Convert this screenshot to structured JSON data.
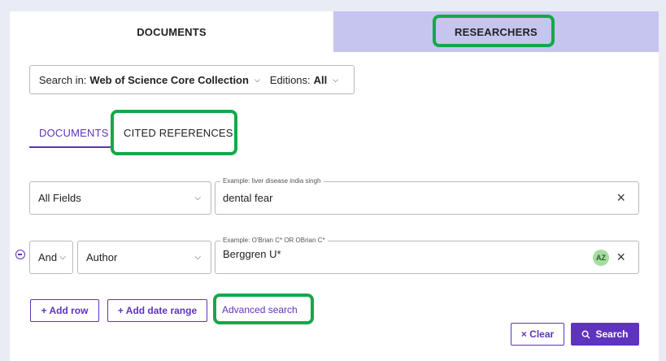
{
  "top_tabs": {
    "documents": "DOCUMENTS",
    "researchers": "RESEARCHERS"
  },
  "search_in": {
    "label": "Search in:",
    "collection": "Web of Science Core Collection",
    "editions_label": "Editions:",
    "editions_value": "All"
  },
  "sub_tabs": {
    "documents": "DOCUMENTS",
    "cited_references": "CITED REFERENCES"
  },
  "rows": [
    {
      "field": "All Fields",
      "example": "Example: liver disease india singh",
      "value": "dental fear"
    },
    {
      "operator": "And",
      "field": "Author",
      "example": "Example: O'Brian C* OR OBrian C*",
      "value": "Berggren U*",
      "az_label": "AZ"
    }
  ],
  "buttons": {
    "add_row": "+ Add row",
    "add_date_range": "+ Add date range",
    "advanced_search": "Advanced search",
    "clear": "× Clear",
    "search": "Search"
  },
  "icons": {
    "close": "×",
    "chevron_down": "⌄",
    "search": "magnifier",
    "remove_row": "minus-circle"
  },
  "colors": {
    "accent": "#5e33bf",
    "highlight": "#14a84a",
    "researchers_tab_bg": "#c5c5f0",
    "az_badge": "#a6dca0"
  }
}
